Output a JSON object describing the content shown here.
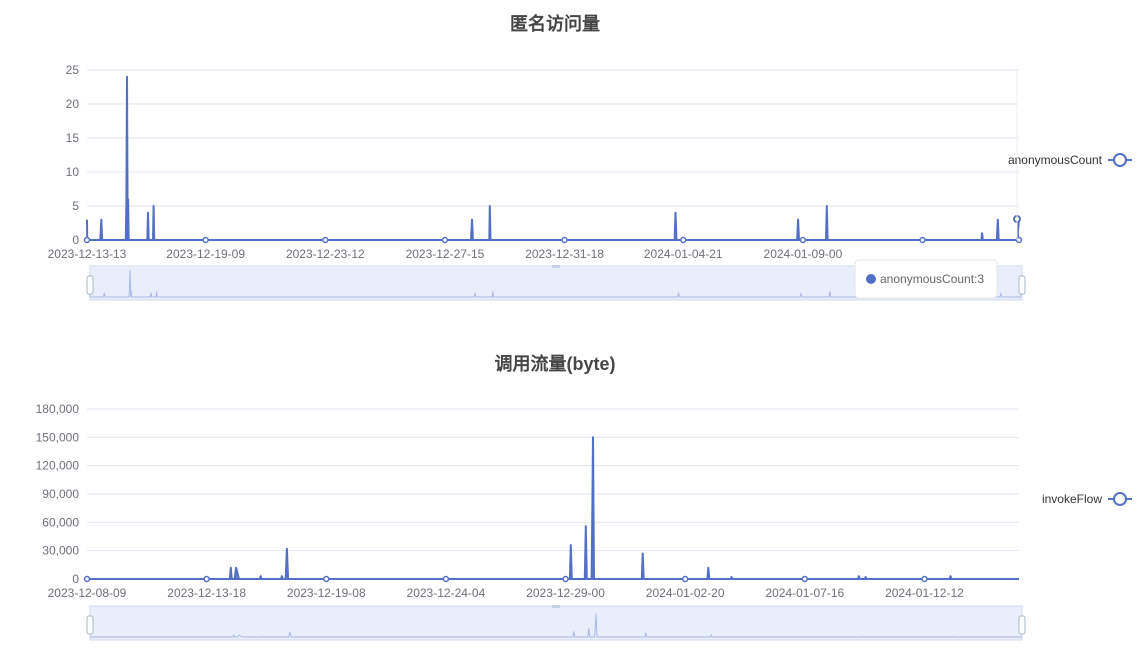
{
  "colors": {
    "series": "#5470c6",
    "grid": "#e0e6f1",
    "axis": "#6e7079",
    "zoom_fill": "#e8eefb",
    "zoom_border": "#d2dbee"
  },
  "tooltip": {
    "text": "anonymousCount:3"
  },
  "chart_data": [
    {
      "type": "area",
      "title": "匿名访问量",
      "legend": {
        "entries": [
          "anonymousCount"
        ],
        "position": "right"
      },
      "series": [
        {
          "name": "anonymousCount",
          "points": [
            [
              0,
              3
            ],
            [
              0.02,
              0
            ],
            [
              1.38,
              0
            ],
            [
              1.48,
              3
            ],
            [
              1.58,
              0
            ],
            [
              4.02,
              0
            ],
            [
              4.08,
              6
            ],
            [
              4.15,
              24
            ],
            [
              4.22,
              0
            ],
            [
              4.26,
              6
            ],
            [
              4.32,
              0
            ],
            [
              6.25,
              0
            ],
            [
              6.32,
              4
            ],
            [
              6.4,
              0
            ],
            [
              6.84,
              0
            ],
            [
              6.9,
              5
            ],
            [
              6.96,
              0
            ],
            [
              39.8,
              0
            ],
            [
              39.9,
              3
            ],
            [
              40.0,
              0
            ],
            [
              41.7,
              0
            ],
            [
              41.75,
              5
            ],
            [
              41.82,
              0
            ],
            [
              60.9,
              0
            ],
            [
              61.0,
              4
            ],
            [
              61.1,
              0
            ],
            [
              73.6,
              0
            ],
            [
              73.7,
              3
            ],
            [
              73.8,
              0
            ],
            [
              76.6,
              0
            ],
            [
              76.68,
              5
            ],
            [
              76.76,
              0
            ],
            [
              92.7,
              0
            ],
            [
              92.78,
              1
            ],
            [
              92.86,
              0
            ],
            [
              94.3,
              0
            ],
            [
              94.4,
              3
            ],
            [
              94.5,
              0
            ],
            [
              96.4,
              0
            ],
            [
              96.6,
              3
            ]
          ]
        }
      ],
      "x_range": [
        0,
        96.6
      ],
      "ylim": [
        0,
        25
      ],
      "y_ticks": [
        0,
        5,
        10,
        15,
        20,
        25
      ],
      "x_ticks": [
        {
          "value": 0,
          "label": "2023-12-13-13"
        },
        {
          "value": 12.3,
          "label": "2023-12-19-09"
        },
        {
          "value": 24.7,
          "label": "2023-12-23-12"
        },
        {
          "value": 37.1,
          "label": "2023-12-27-15"
        },
        {
          "value": 49.5,
          "label": "2023-12-31-18"
        },
        {
          "value": 61.8,
          "label": "2024-01-04-21"
        },
        {
          "value": 74.2,
          "label": "2024-01-09-00"
        }
      ],
      "x_tick_dots": [
        0,
        12.3,
        24.7,
        37.1,
        49.5,
        61.8,
        74.2,
        86.6,
        96.6
      ],
      "grid": true
    },
    {
      "type": "area",
      "title": "调用流量(byte)",
      "legend": {
        "entries": [
          "invokeFlow"
        ],
        "position": "right"
      },
      "series": [
        {
          "name": "invokeFlow",
          "points": [
            [
              0,
              0
            ],
            [
              14.8,
              0
            ],
            [
              14.9,
              12000
            ],
            [
              15.0,
              0
            ],
            [
              15.3,
              0
            ],
            [
              15.45,
              12000
            ],
            [
              15.6,
              6000
            ],
            [
              15.75,
              0
            ],
            [
              17.9,
              0
            ],
            [
              18.0,
              3000
            ],
            [
              18.1,
              0
            ],
            [
              20.1,
              0
            ],
            [
              20.2,
              3000
            ],
            [
              20.3,
              0
            ],
            [
              20.6,
              0
            ],
            [
              20.72,
              32000
            ],
            [
              20.84,
              0
            ],
            [
              50.05,
              0
            ],
            [
              50.15,
              36000
            ],
            [
              50.25,
              0
            ],
            [
              51.6,
              0
            ],
            [
              51.7,
              56000
            ],
            [
              51.8,
              0
            ],
            [
              52.3,
              0
            ],
            [
              52.38,
              80000
            ],
            [
              52.45,
              150000
            ],
            [
              52.55,
              0
            ],
            [
              57.5,
              0
            ],
            [
              57.6,
              27000
            ],
            [
              57.7,
              0
            ],
            [
              64.3,
              0
            ],
            [
              64.4,
              12000
            ],
            [
              64.5,
              0
            ],
            [
              66.7,
              0
            ],
            [
              66.8,
              2000
            ],
            [
              66.9,
              0
            ],
            [
              79.9,
              0
            ],
            [
              80.0,
              3000
            ],
            [
              80.1,
              0
            ],
            [
              80.6,
              0
            ],
            [
              80.7,
              2000
            ],
            [
              80.8,
              0
            ],
            [
              89.4,
              0
            ],
            [
              89.5,
              3000
            ],
            [
              89.6,
              0
            ],
            [
              96.6,
              0
            ]
          ]
        }
      ],
      "x_range": [
        0,
        96.6
      ],
      "ylim": [
        0,
        180000
      ],
      "y_ticks": [
        0,
        30000,
        60000,
        90000,
        120000,
        150000,
        180000
      ],
      "y_tick_labels": [
        "0",
        "30,000",
        "60,000",
        "90,000",
        "120,000",
        "150,000",
        "180,000"
      ],
      "x_ticks": [
        {
          "value": 0,
          "label": "2023-12-08-09"
        },
        {
          "value": 12.4,
          "label": "2023-12-13-18"
        },
        {
          "value": 24.8,
          "label": "2023-12-19-08"
        },
        {
          "value": 37.2,
          "label": "2023-12-24-04"
        },
        {
          "value": 49.6,
          "label": "2023-12-29-00"
        },
        {
          "value": 62.0,
          "label": "2024-01-02-20"
        },
        {
          "value": 74.4,
          "label": "2024-01-07-16"
        },
        {
          "value": 86.8,
          "label": "2024-01-12-12"
        }
      ],
      "x_tick_dots": [
        0,
        12.4,
        24.8,
        37.2,
        49.6,
        62.0,
        74.4,
        86.8
      ],
      "grid": true
    }
  ]
}
